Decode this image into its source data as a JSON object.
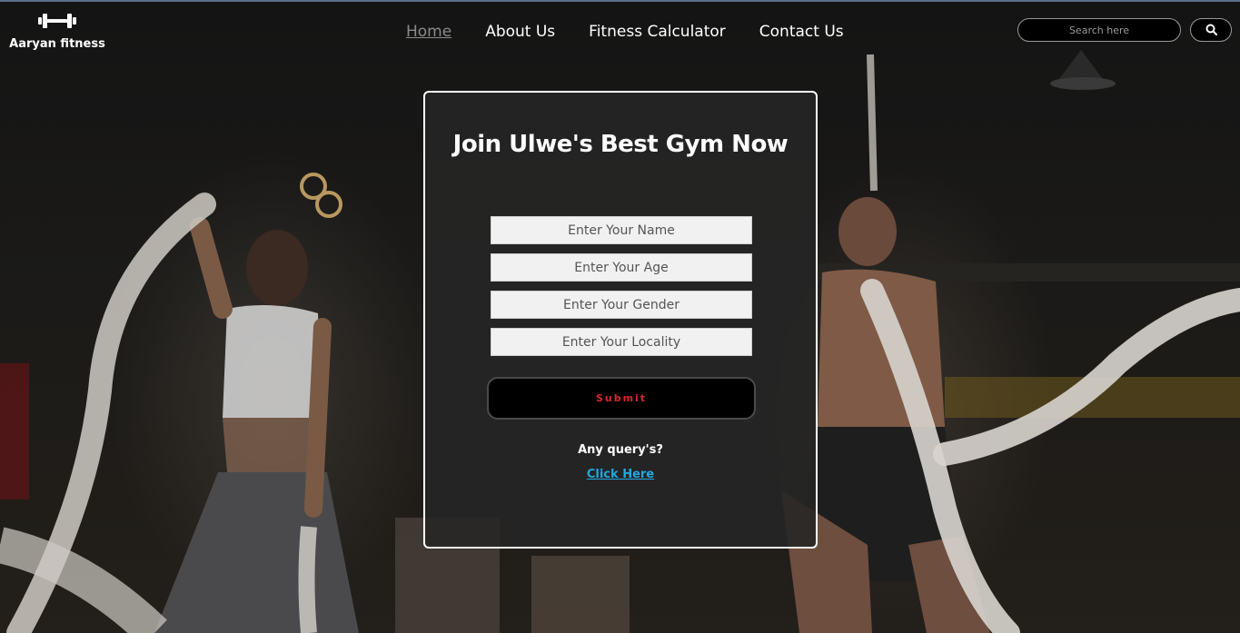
{
  "header": {
    "logo_text": "Aaryan fitness",
    "logo_icon": "dumbbell-icon",
    "nav": [
      {
        "label": "Home",
        "active": true
      },
      {
        "label": "About Us",
        "active": false
      },
      {
        "label": "Fitness Calculator",
        "active": false
      },
      {
        "label": "Contact Us",
        "active": false
      }
    ],
    "search": {
      "placeholder": "Search here",
      "icon": "search-icon"
    }
  },
  "form": {
    "title": "Join Ulwe's Best Gym Now",
    "fields": [
      {
        "placeholder": "Enter Your Name",
        "value": ""
      },
      {
        "placeholder": "Enter Your Age",
        "value": ""
      },
      {
        "placeholder": "Enter Your Gender",
        "value": ""
      },
      {
        "placeholder": "Enter Your Locality",
        "value": ""
      }
    ],
    "submit_label": "Submit",
    "query_text": "Any query's?",
    "query_link": "Click Here"
  },
  "colors": {
    "accent_link": "#22a7e0",
    "submit_text": "#d9252b",
    "card_border": "#ffffff"
  }
}
